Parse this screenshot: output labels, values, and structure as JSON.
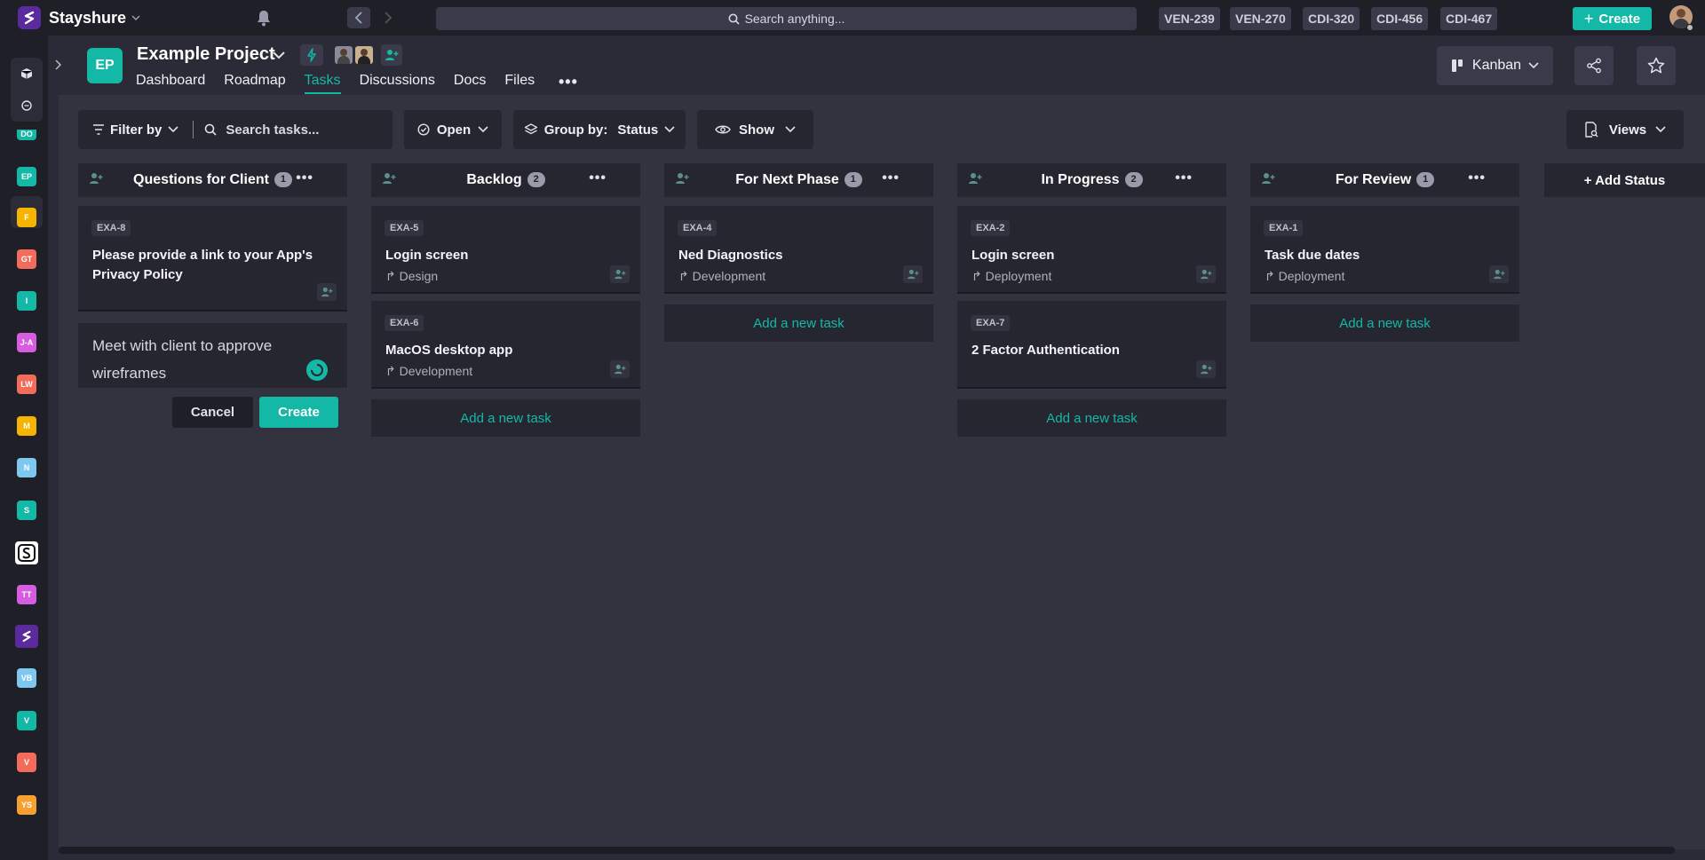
{
  "app": {
    "name": "Stayshure"
  },
  "search": {
    "placeholder": "Search anything..."
  },
  "recent_items": [
    "VEN-239",
    "VEN-270",
    "CDI-320",
    "CDI-456",
    "CDI-467"
  ],
  "create_label": "Create",
  "projects": [
    {
      "abbr": "DO",
      "color": "#14b8a6"
    },
    {
      "abbr": "EP",
      "color": "#14b8a6"
    },
    {
      "abbr": "F",
      "color": "#f5b400"
    },
    {
      "abbr": "GT",
      "color": "#f26b5b"
    },
    {
      "abbr": "I",
      "color": "#14b8a6"
    },
    {
      "abbr": "J-A",
      "color": "#d65ce0"
    },
    {
      "abbr": "LW",
      "color": "#f26b5b"
    },
    {
      "abbr": "M",
      "color": "#f5b400"
    },
    {
      "abbr": "N",
      "color": "#7ec8f0"
    },
    {
      "abbr": "S",
      "color": "#14b8a6"
    },
    {
      "abbr": "",
      "color": "#ffffff"
    },
    {
      "abbr": "TT",
      "color": "#d65ce0"
    },
    {
      "abbr": "",
      "color": "#5b2a9c"
    },
    {
      "abbr": "VB",
      "color": "#7ec8f0"
    },
    {
      "abbr": "V",
      "color": "#14b8a6"
    },
    {
      "abbr": "V",
      "color": "#f26b5b"
    },
    {
      "abbr": "YS",
      "color": "#f5a030"
    }
  ],
  "project": {
    "badge": "EP",
    "title": "Example Project",
    "tabs": [
      "Dashboard",
      "Roadmap",
      "Tasks",
      "Discussions",
      "Docs",
      "Files"
    ],
    "active_tab": "Tasks",
    "more": "•••"
  },
  "view": {
    "label": "Kanban"
  },
  "toolbar": {
    "filter_label": "Filter by",
    "search_placeholder": "Search tasks...",
    "open_label": "Open",
    "group_by_label": "Group by:",
    "group_by_value": "Status",
    "show_label": "Show",
    "views_label": "Views"
  },
  "columns": [
    {
      "title": "Questions for Client",
      "count": "1"
    },
    {
      "title": "Backlog",
      "count": "2"
    },
    {
      "title": "For Next Phase",
      "count": "1"
    },
    {
      "title": "In Progress",
      "count": "2"
    },
    {
      "title": "For Review",
      "count": "1"
    }
  ],
  "add_status_label": "+ Add Status",
  "cards": {
    "c1": {
      "key": "EXA-8",
      "title": "Please provide a link to your App's Privacy Policy"
    },
    "c2": {
      "key": "EXA-5",
      "title": "Login screen",
      "sub": "Design"
    },
    "c3": {
      "key": "EXA-6",
      "title": "MacOS desktop app",
      "sub": "Development"
    },
    "c4": {
      "key": "EXA-4",
      "title": "Ned Diagnostics",
      "sub": "Development"
    },
    "c5": {
      "key": "EXA-2",
      "title": "Login screen",
      "sub": "Deployment"
    },
    "c6": {
      "key": "EXA-7",
      "title": "2 Factor Authentication"
    },
    "c7": {
      "key": "EXA-1",
      "title": "Task due dates",
      "sub": "Deployment"
    }
  },
  "add_task_label": "Add a new task",
  "new_task": {
    "value": "Meet with client to approve wireframes",
    "cancel": "Cancel",
    "create": "Create"
  },
  "colors": {
    "accent": "#14b8a6",
    "background": "#2b2b37",
    "card": "#262630",
    "topbar": "#1f1f28"
  }
}
